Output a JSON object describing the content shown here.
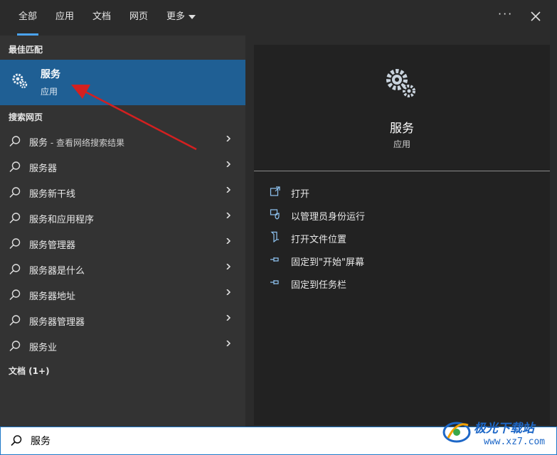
{
  "tabs": [
    {
      "label": "全部",
      "active": true
    },
    {
      "label": "应用"
    },
    {
      "label": "文档"
    },
    {
      "label": "网页"
    },
    {
      "label": "更多"
    }
  ],
  "sections": {
    "best_match": "最佳匹配",
    "search_web": "搜索网页",
    "documents": "文档 (1+)"
  },
  "best_match": {
    "title": "服务",
    "subtitle": "应用",
    "icon": "gears-icon"
  },
  "web_results": [
    {
      "main": "服务",
      "suffix": " - 查看网络搜索结果"
    },
    {
      "main": "服务器",
      "suffix": ""
    },
    {
      "main": "服务新干线",
      "suffix": ""
    },
    {
      "main": "服务和应用程序",
      "suffix": ""
    },
    {
      "main": "服务管理器",
      "suffix": ""
    },
    {
      "main": "服务器是什么",
      "suffix": ""
    },
    {
      "main": "服务器地址",
      "suffix": ""
    },
    {
      "main": "服务器管理器",
      "suffix": ""
    },
    {
      "main": "服务业",
      "suffix": ""
    }
  ],
  "detail": {
    "title": "服务",
    "subtitle": "应用",
    "actions": [
      {
        "label": "打开",
        "icon": "open-icon"
      },
      {
        "label": "以管理员身份运行",
        "icon": "shield-icon"
      },
      {
        "label": "打开文件位置",
        "icon": "folder-icon"
      },
      {
        "label": "固定到\"开始\"屏幕",
        "icon": "pin-icon"
      },
      {
        "label": "固定到任务栏",
        "icon": "pin-icon"
      }
    ]
  },
  "search": {
    "value": "服务"
  },
  "watermark": {
    "text": "极光下载站",
    "url": "www.xz7.com"
  },
  "colors": {
    "accent": "#4aa3f0",
    "selected": "#1f5f94",
    "annotation_arrow": "#d42020"
  }
}
